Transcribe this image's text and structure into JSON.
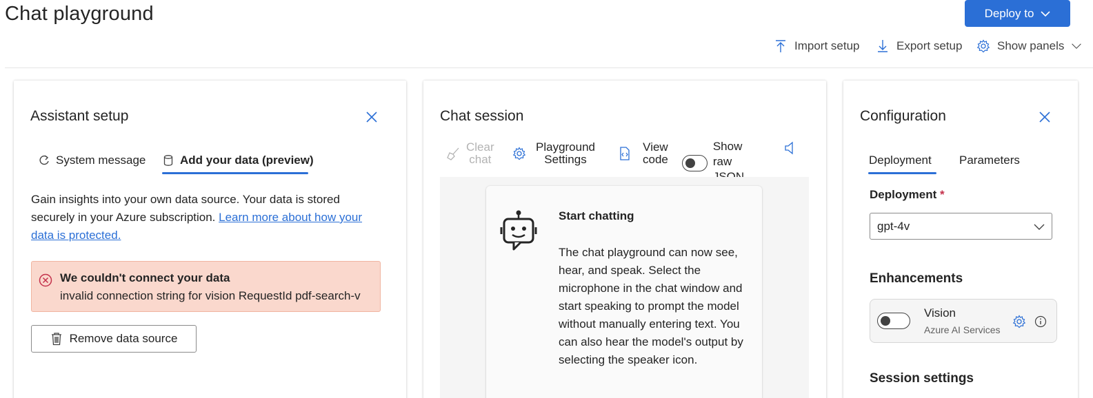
{
  "header": {
    "title": "Chat playground",
    "deploy_label": "Deploy to",
    "import_label": "Import setup",
    "export_label": "Export setup",
    "panels_label": "Show panels"
  },
  "assistant": {
    "title": "Assistant setup",
    "tabs": [
      {
        "label": "System message",
        "icon": "refresh-icon"
      },
      {
        "label": "Add your data (preview)",
        "icon": "database-icon",
        "selected": true
      }
    ],
    "intro_text": "Gain insights into your own data source. Your data is stored securely in your Azure subscription. ",
    "intro_link": "Learn more about how your data is protected.",
    "error_title": "We couldn't connect your data",
    "error_message": "invalid connection string for vision RequestId pdf-search-v",
    "remove_label": "Remove data source"
  },
  "chat": {
    "title": "Chat session",
    "clear_label_1": "Clear",
    "clear_label_2": "chat",
    "settings_label_1": "Playground",
    "settings_label_2": "Settings",
    "viewcode_label_1": "View",
    "viewcode_label_2": "code",
    "rawjson_label_1": "Show raw",
    "rawjson_label_2": "JSON",
    "start_title": "Start chatting",
    "start_body": "The chat playground can now see, hear, and speak. Select the microphone in the chat window and start speaking to prompt the model without manually entering text. You can also hear the model's output by selecting the speaker icon."
  },
  "config": {
    "title": "Configuration",
    "tabs": [
      {
        "label": "Deployment",
        "selected": true
      },
      {
        "label": "Parameters"
      }
    ],
    "deployment_label": "Deployment",
    "required_mark": "*",
    "deployment_value": "gpt-4v",
    "enhancements_heading": "Enhancements",
    "vision_title": "Vision",
    "vision_subtitle": "Azure AI Services",
    "session_heading": "Session settings"
  },
  "colors": {
    "accent": "#2b6fd6",
    "error_bg": "#fad8cd",
    "error_icon": "#c4314b"
  }
}
